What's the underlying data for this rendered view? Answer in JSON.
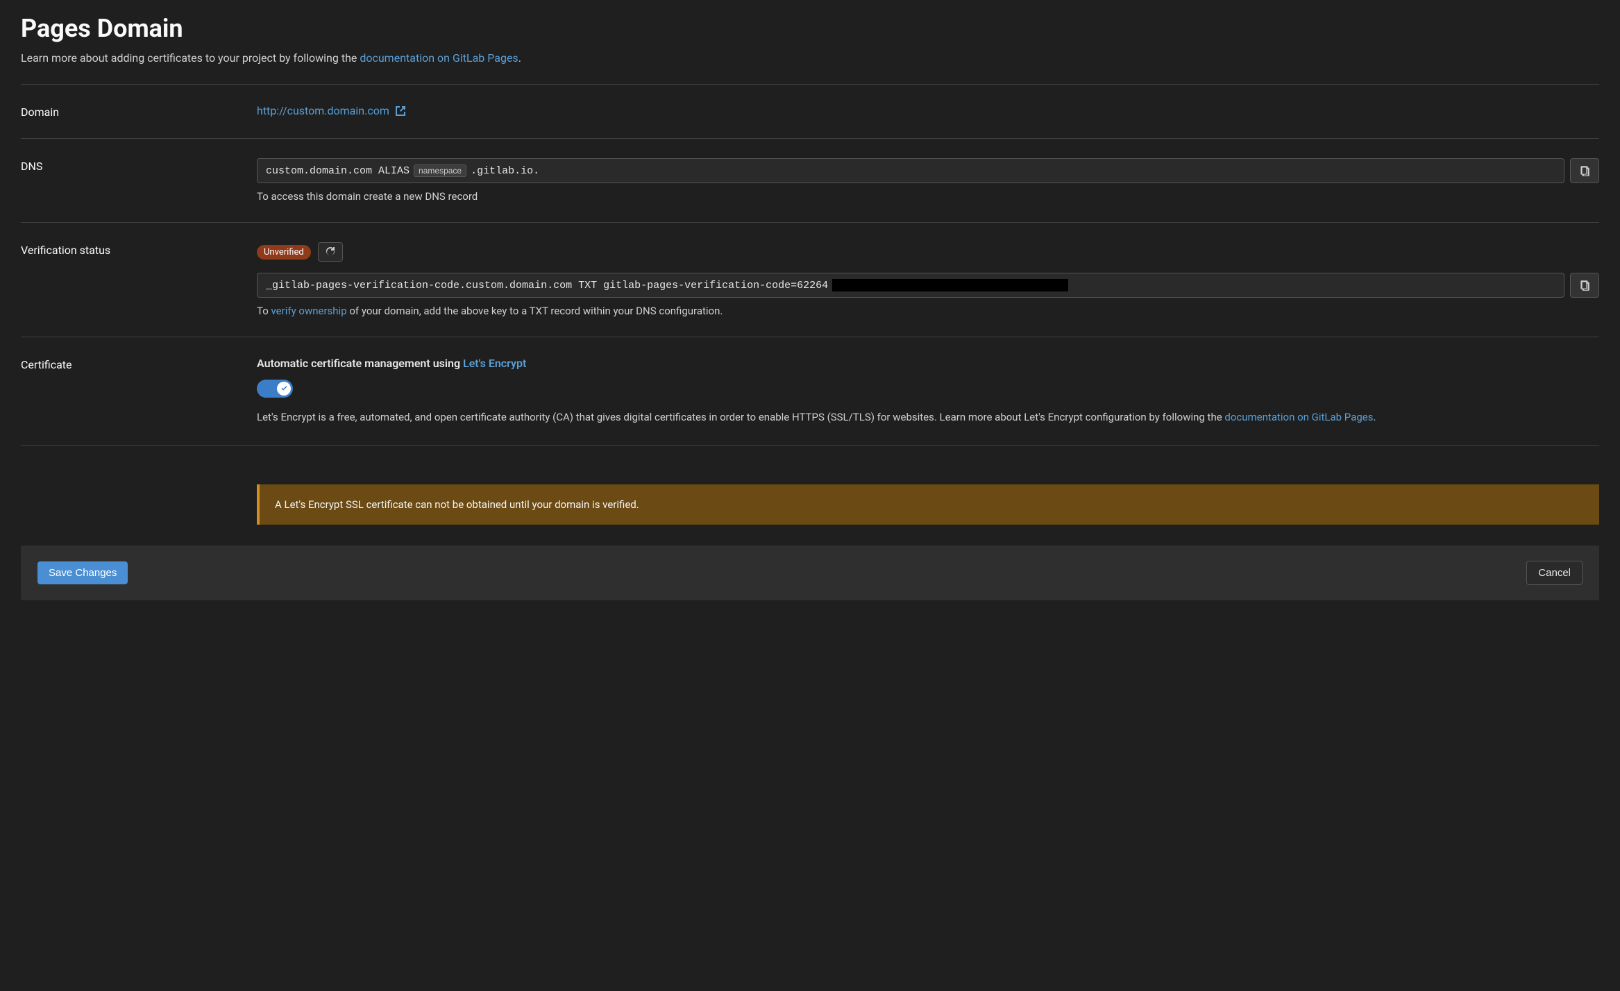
{
  "page": {
    "title": "Pages Domain",
    "intro_prefix": "Learn more about adding certificates to your project by following the ",
    "intro_link": "documentation on GitLab Pages",
    "intro_suffix": "."
  },
  "domain": {
    "label": "Domain",
    "url": "http://custom.domain.com"
  },
  "dns": {
    "label": "DNS",
    "record_prefix": "custom.domain.com ALIAS ",
    "namespace_label": "namespace",
    "record_suffix": ".gitlab.io.",
    "help": "To access this domain create a new DNS record"
  },
  "verification": {
    "label": "Verification status",
    "badge": "Unverified",
    "txt_record": "_gitlab-pages-verification-code.custom.domain.com TXT gitlab-pages-verification-code=62264",
    "help_prefix": "To ",
    "help_link": "verify ownership",
    "help_suffix": " of your domain, add the above key to a TXT record within your DNS configuration."
  },
  "certificate": {
    "label": "Certificate",
    "heading_prefix": "Automatic certificate management using ",
    "heading_link": "Let's Encrypt",
    "toggle_on": true,
    "desc_prefix": "Let's Encrypt is a free, automated, and open certificate authority (CA) that gives digital certificates in order to enable HTTPS (SSL/TLS) for websites. Learn more about Let's Encrypt configuration by following the ",
    "desc_link": "documentation on GitLab Pages",
    "desc_suffix": "."
  },
  "alert": {
    "message": "A Let's Encrypt SSL certificate can not be obtained until your domain is verified."
  },
  "footer": {
    "save": "Save Changes",
    "cancel": "Cancel"
  }
}
